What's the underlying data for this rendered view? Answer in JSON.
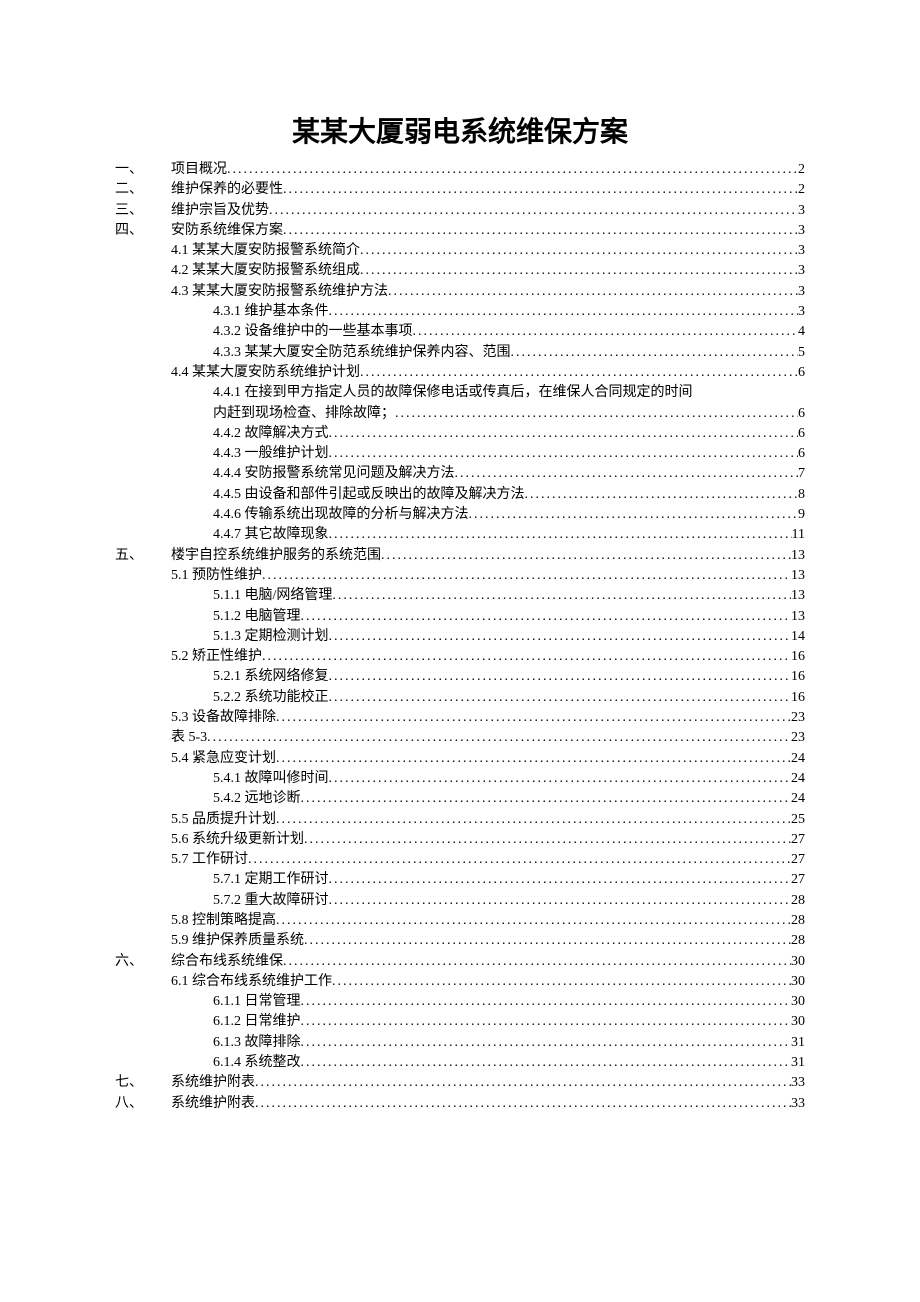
{
  "title": "某某大厦弱电系统维保方案",
  "toc": [
    {
      "level": 0,
      "marker": "一、",
      "label": "项目概况",
      "page": "2"
    },
    {
      "level": 0,
      "marker": "二、",
      "label": "维护保养的必要性",
      "page": "2"
    },
    {
      "level": 0,
      "marker": "三、",
      "label": "维护宗旨及优势",
      "page": "3"
    },
    {
      "level": 0,
      "marker": "四、",
      "label": "安防系统维保方案",
      "page": "3"
    },
    {
      "level": 1,
      "marker": "",
      "label": "4.1 某某大厦安防报警系统简介",
      "page": "3"
    },
    {
      "level": 1,
      "marker": "",
      "label": "4.2 某某大厦安防报警系统组成",
      "page": "3"
    },
    {
      "level": 1,
      "marker": "",
      "label": "4.3 某某大厦安防报警系统维护方法",
      "page": "3"
    },
    {
      "level": 2,
      "marker": "",
      "label": "4.3.1 维护基本条件",
      "page": "3"
    },
    {
      "level": 2,
      "marker": "",
      "label": "4.3.2 设备维护中的一些基本事项",
      "page": "4"
    },
    {
      "level": 2,
      "marker": "",
      "label": "4.3.3 某某大厦安全防范系统维护保养内容、范围",
      "page": "5"
    },
    {
      "level": 1,
      "marker": "",
      "label": "4.4 某某大厦安防系统维护计划",
      "page": "6"
    },
    {
      "level": 2,
      "marker": "",
      "label": "4.4.1 在接到甲方指定人员的故障保修电话或传真后，在维保人合同规定的时间内赶到现场检查、排除故障；",
      "page": "6",
      "wrap": true
    },
    {
      "level": 2,
      "marker": "",
      "label": "4.4.2 故障解决方式",
      "page": "6"
    },
    {
      "level": 2,
      "marker": "",
      "label": "4.4.3 一般维护计划",
      "page": "6"
    },
    {
      "level": 2,
      "marker": "",
      "label": "4.4.4 安防报警系统常见问题及解决方法",
      "page": "7"
    },
    {
      "level": 2,
      "marker": "",
      "label": "4.4.5 由设备和部件引起或反映出的故障及解决方法",
      "page": "8"
    },
    {
      "level": 2,
      "marker": "",
      "label": "4.4.6 传输系统出现故障的分析与解决方法",
      "page": "9"
    },
    {
      "level": 2,
      "marker": "",
      "label": "4.4.7 其它故障现象",
      "page": "11"
    },
    {
      "level": 0,
      "marker": "五、",
      "label": "楼宇自控系统维护服务的系统范围",
      "page": "13"
    },
    {
      "level": 1,
      "marker": "",
      "label": "5.1 预防性维护",
      "page": "13"
    },
    {
      "level": 2,
      "marker": "",
      "label": "5.1.1 电脑/网络管理",
      "page": "13"
    },
    {
      "level": 2,
      "marker": "",
      "label": "5.1.2 电脑管理",
      "page": "13"
    },
    {
      "level": 2,
      "marker": "",
      "label": "5.1.3 定期检测计划",
      "page": "14"
    },
    {
      "level": 1,
      "marker": "",
      "label": "5.2 矫正性维护",
      "page": "16"
    },
    {
      "level": 2,
      "marker": "",
      "label": "5.2.1 系统网络修复",
      "page": "16"
    },
    {
      "level": 2,
      "marker": "",
      "label": "5.2.2 系统功能校正",
      "page": "16"
    },
    {
      "level": 1,
      "marker": "",
      "label": "5.3 设备故障排除",
      "page": "23"
    },
    {
      "level": 1,
      "marker": "",
      "label": "表 5-3",
      "page": "23"
    },
    {
      "level": 1,
      "marker": "",
      "label": "5.4 紧急应变计划",
      "page": "24"
    },
    {
      "level": 2,
      "marker": "",
      "label": "5.4.1 故障叫修时间",
      "page": "24"
    },
    {
      "level": 2,
      "marker": "",
      "label": "5.4.2 远地诊断",
      "page": "24"
    },
    {
      "level": 1,
      "marker": "",
      "label": "5.5 品质提升计划",
      "page": "25"
    },
    {
      "level": 1,
      "marker": "",
      "label": "5.6 系统升级更新计划",
      "page": "27"
    },
    {
      "level": 1,
      "marker": "",
      "label": "5.7 工作研讨",
      "page": "27"
    },
    {
      "level": 2,
      "marker": "",
      "label": "5.7.1 定期工作研讨",
      "page": "27"
    },
    {
      "level": 2,
      "marker": "",
      "label": "5.7.2 重大故障研讨",
      "page": "28"
    },
    {
      "level": 1,
      "marker": "",
      "label": "5.8 控制策略提高",
      "page": "28"
    },
    {
      "level": 1,
      "marker": "",
      "label": "5.9 维护保养质量系统",
      "page": "28"
    },
    {
      "level": 0,
      "marker": "六、",
      "label": "综合布线系统维保",
      "page": "30"
    },
    {
      "level": 1,
      "marker": "",
      "label": "6.1 综合布线系统维护工作",
      "page": "30"
    },
    {
      "level": 2,
      "marker": "",
      "label": "6.1.1 日常管理",
      "page": "30"
    },
    {
      "level": 2,
      "marker": "",
      "label": "6.1.2 日常维护",
      "page": "30"
    },
    {
      "level": 2,
      "marker": "",
      "label": "6.1.3 故障排除",
      "page": "31"
    },
    {
      "level": 2,
      "marker": "",
      "label": "6.1.4 系统整改",
      "page": "31"
    },
    {
      "level": 0,
      "marker": "七、",
      "label": "系统维护附表",
      "page": "33"
    },
    {
      "level": 0,
      "marker": "八、",
      "label": "系统维护附表",
      "page": "33"
    }
  ]
}
